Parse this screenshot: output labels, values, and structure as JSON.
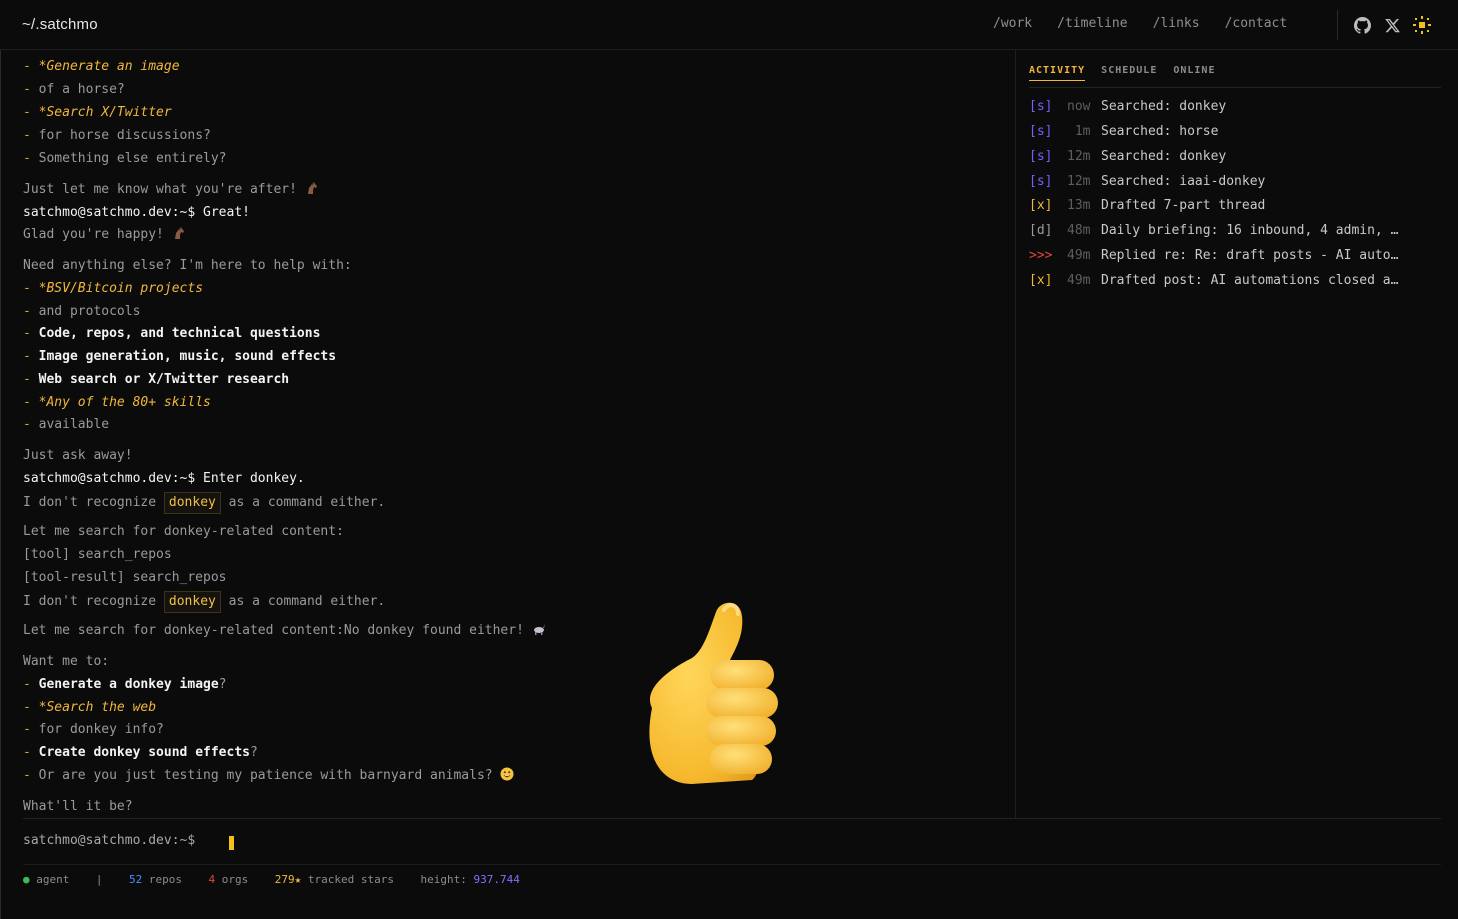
{
  "header": {
    "brand": "~/.satchmo",
    "nav": [
      "/work",
      "/timeline",
      "/links",
      "/contact"
    ]
  },
  "icons": {
    "github": "github-icon",
    "x": "x-icon",
    "theme": "sun-icon"
  },
  "colors": {
    "accent": "#f2b73a",
    "search_tag": "#7a5cff",
    "reply_tag": "#e0463a",
    "cursor": "#f2c01a"
  },
  "chat": {
    "l1_dash": "- ",
    "l1": "*Generate an image",
    "l2_dash": "- ",
    "l2": "of a horse?",
    "l3_dash": "- ",
    "l3": "*Search X/Twitter",
    "l4_dash": "- ",
    "l4": "for horse discussions?",
    "l5_dash": "- ",
    "l5": "Something else entirely?",
    "l6": "Just let me know what you're after! ",
    "l7": "satchmo@satchmo.dev:~$ Great!",
    "l8": "Glad you're happy! ",
    "l9": "Need anything else? I'm here to help with:",
    "l10_dash": "- ",
    "l10": "*BSV/Bitcoin projects",
    "l11_dash": "- ",
    "l11": "and protocols",
    "l12_dash": "- ",
    "l12": "Code, repos, and technical questions",
    "l13_dash": "- ",
    "l13": "Image generation, music, sound effects",
    "l14_dash": "- ",
    "l14": "Web search or X/Twitter research",
    "l15_dash": "- ",
    "l15": "*Any of the 80+ skills",
    "l16_dash": "- ",
    "l16": "available",
    "l17": "Just ask away!",
    "l18": "satchmo@satchmo.dev:~$ Enter donkey.",
    "l19a": "I don't recognize ",
    "l19kw": "donkey",
    "l19b": " as a command either.",
    "l20": "Let me search for donkey-related content:",
    "l21": "[tool] search_repos",
    "l22": "[tool-result] search_repos",
    "l23a": "I don't recognize ",
    "l23kw": "donkey",
    "l23b": " as a command either.",
    "l24": "Let me search for donkey-related content:No donkey found either! ",
    "l25": "Want me to:",
    "l26_dash": "- ",
    "l26": "Generate a donkey image",
    "l26q": "?",
    "l27_dash": "- ",
    "l27": "*Search the web",
    "l28_dash": "- ",
    "l28": "for donkey info?",
    "l29_dash": "- ",
    "l29": "Create donkey sound effects",
    "l29q": "?",
    "l30_dash": "- ",
    "l30": "Or are you just testing my patience with barnyard animals? ",
    "l31": "What'll it be?"
  },
  "panel": {
    "tabs": [
      "ACTIVITY",
      "SCHEDULE",
      "ONLINE"
    ],
    "activity": [
      {
        "tag": "[s]",
        "time": "now",
        "text": "Searched: donkey"
      },
      {
        "tag": "[s]",
        "time": " 1m",
        "text": "Searched: horse"
      },
      {
        "tag": "[s]",
        "time": "12m",
        "text": "Searched: donkey"
      },
      {
        "tag": "[s]",
        "time": "12m",
        "text": "Searched: iaai-donkey"
      },
      {
        "tag": "[x]",
        "time": "13m",
        "text": "Drafted 7-part thread"
      },
      {
        "tag": "[d]",
        "time": "48m",
        "text": "Daily briefing: 16 inbound, 4 admin, …"
      },
      {
        "tag": ">>>",
        "time": "49m",
        "text": "Replied re: Re: draft posts - AI auto…"
      },
      {
        "tag": "[x]",
        "time": "49m",
        "text": "Drafted post: AI automations closed a…"
      }
    ]
  },
  "input": {
    "prompt": "satchmo@satchmo.dev:~$"
  },
  "status": {
    "agent": "agent",
    "sep": "|",
    "repos_n": "52",
    "repos_l": "repos",
    "orgs_n": "4",
    "orgs_l": "orgs",
    "stars_n": "279★",
    "stars_l": "tracked stars",
    "height_l": "height:",
    "height_v": "937.744"
  }
}
